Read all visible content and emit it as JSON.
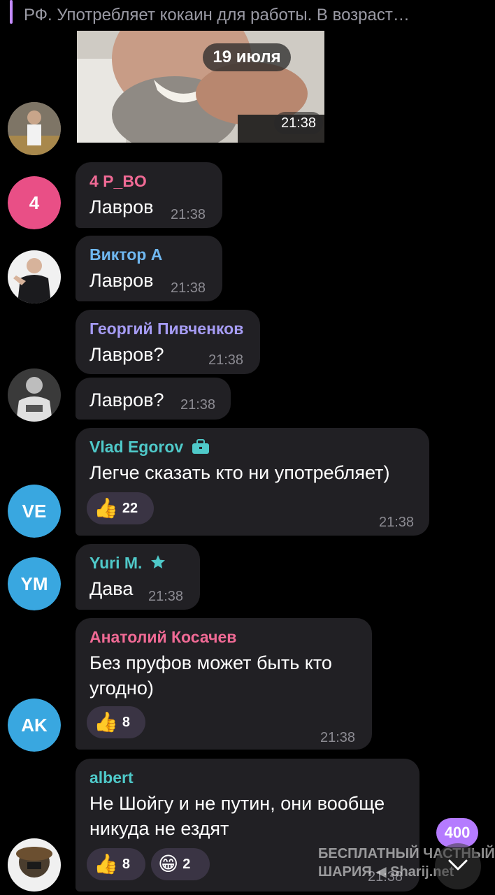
{
  "reply_preview": {
    "text": "РФ. Употребляет кокаин для работы.  В возраст…"
  },
  "date_separator": "19 июля",
  "photo_message": {
    "time": "21:38"
  },
  "messages": [
    {
      "avatar_text": "4",
      "avatar_color": "#e94f86",
      "sender": "4 P_BO",
      "sender_color": "#f06a95",
      "text": "Лавров",
      "time": "21:38"
    },
    {
      "sender": "Виктор А",
      "sender_color": "#6fb7f0",
      "text": "Лавров",
      "time": "21:38"
    },
    {
      "sender": "Георгий Пивченков",
      "sender_color": "#a69cf4",
      "text": "Лавров?",
      "time": "21:38"
    },
    {
      "text": "Лавров?",
      "time": "21:38"
    },
    {
      "avatar_text": "VE",
      "avatar_color": "#39a7e0",
      "sender": "Vlad Egorov",
      "sender_color": "#4fc9c9",
      "text": "Легче сказать кто ни употребляет)",
      "time": "21:38",
      "reactions": [
        {
          "emoji": "👍",
          "count": "22"
        }
      ]
    },
    {
      "avatar_text": "YM",
      "avatar_color": "#39a7e0",
      "sender": "Yuri M.",
      "sender_color": "#4fc9c9",
      "text": "Дава",
      "time": "21:38"
    },
    {
      "avatar_text": "AK",
      "avatar_color": "#39a7e0",
      "sender": "Анатолий Косачев",
      "sender_color": "#f06a95",
      "text_lines": [
        "Без пруфов может быть кто",
        "угодно)"
      ],
      "time": "21:38",
      "reactions": [
        {
          "emoji": "👍",
          "count": "8"
        }
      ]
    },
    {
      "sender": "albert",
      "sender_color": "#4fc9c9",
      "text_lines": [
        "Не Шойгу и не путин, они вообще",
        "никуда не ездят"
      ],
      "time": "21:38",
      "reactions": [
        {
          "emoji": "👍",
          "count": "8"
        },
        {
          "emoji": "😁",
          "count": "2"
        }
      ]
    }
  ],
  "unread_count": "400",
  "watermark": {
    "line1": "БЕСПЛАТНЫЙ  ЧАСТНЫЙ",
    "line2": "ШАРИЯ ◀ Sharij.net"
  },
  "icons": {
    "briefcase": "briefcase-icon",
    "star": "star-icon",
    "scroll_down": "chevron-down-icon"
  }
}
